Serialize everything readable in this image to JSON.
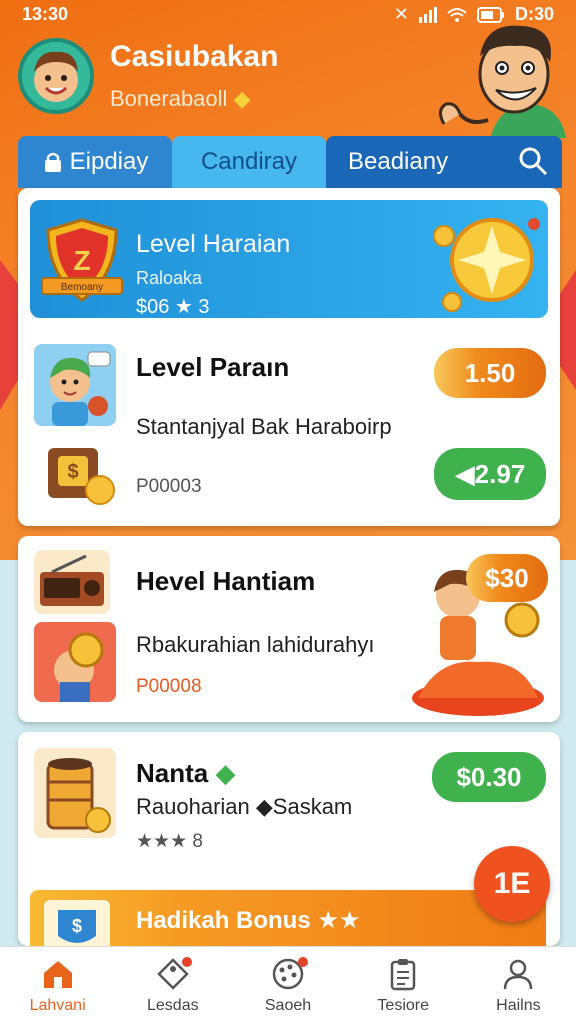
{
  "status_bar": {
    "time": "13:30",
    "time_right": "D:30"
  },
  "header": {
    "title": "Casiubakan",
    "subtitle": "Bonerabaoll"
  },
  "tabs": [
    {
      "label": "Eipdiay"
    },
    {
      "label": "Candiray"
    },
    {
      "label": "Beadiany"
    }
  ],
  "banner": {
    "title": "Level Haraian",
    "subtitle": "Raloaka",
    "meta": "$06 ★ 3",
    "shield_text": "Z",
    "ribbon_text": "Bemoany"
  },
  "items": [
    {
      "title": "Level Paraın",
      "subtitle": "Stantanjyal Bak Haraboirp",
      "meta": "P00003",
      "badge_top": "1.50",
      "badge_bottom": "◀2.97"
    },
    {
      "title": "Hevel Hantiam",
      "subtitle": "Rbakurahian lahidurahyı",
      "meta": "P00008",
      "badge_top": "$30"
    },
    {
      "title": "Nanta",
      "subtitle": "Rauoharian ◆Saskam",
      "meta": "★★★ 8",
      "badge_top": "$0.30"
    }
  ],
  "bonus": {
    "title": "Hadikah Bonus ★★"
  },
  "fab": {
    "label": "1E"
  },
  "bottom_nav": [
    {
      "label": "Lahvani",
      "icon": "home-icon",
      "active": true
    },
    {
      "label": "Lesdas",
      "icon": "tag-icon"
    },
    {
      "label": "Saoeh",
      "icon": "palette-icon"
    },
    {
      "label": "Tesiore",
      "icon": "clipboard-icon"
    },
    {
      "label": "Hailns",
      "icon": "person-icon"
    }
  ],
  "colors": {
    "primary_orange": "#f06f12",
    "tab_blue": "#1b67b7",
    "pill_green": "#3fb24e",
    "active_nav": "#e8641b"
  }
}
